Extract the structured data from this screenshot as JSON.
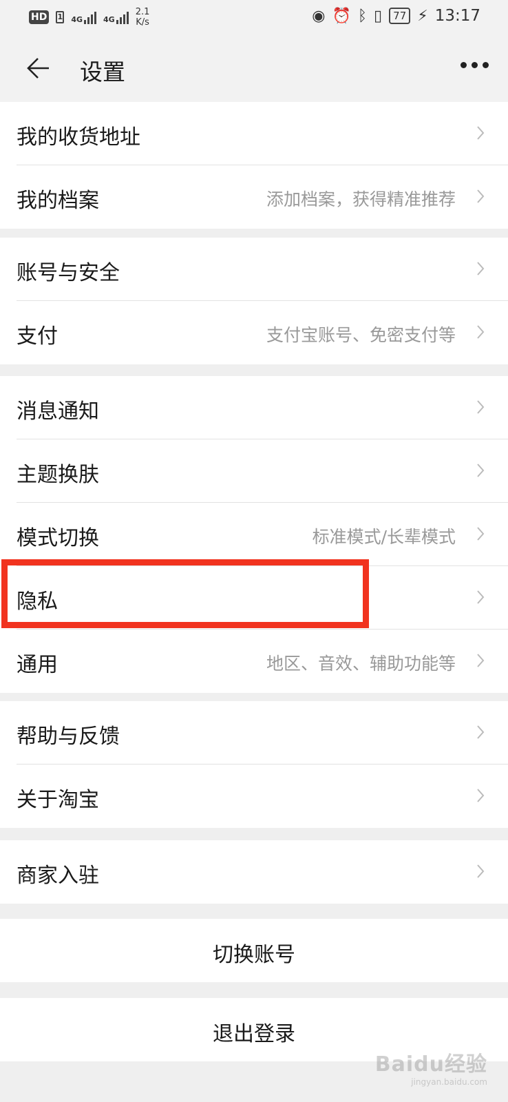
{
  "status_bar": {
    "hd": "HD",
    "sim1": "1",
    "net1": "4G",
    "net2": "4G",
    "speed_value": "2.1",
    "speed_unit": "K/s",
    "battery": "77",
    "time": "13:17"
  },
  "header": {
    "title": "设置"
  },
  "groups": [
    {
      "items": [
        {
          "label": "我的收货地址",
          "hint": ""
        },
        {
          "label": "我的档案",
          "hint": "添加档案，获得精准推荐"
        }
      ]
    },
    {
      "items": [
        {
          "label": "账号与安全",
          "hint": ""
        },
        {
          "label": "支付",
          "hint": "支付宝账号、免密支付等"
        }
      ]
    },
    {
      "items": [
        {
          "label": "消息通知",
          "hint": ""
        },
        {
          "label": "主题换肤",
          "hint": ""
        },
        {
          "label": "模式切换",
          "hint": "标准模式/长辈模式"
        },
        {
          "label": "隐私",
          "hint": ""
        },
        {
          "label": "通用",
          "hint": "地区、音效、辅助功能等"
        }
      ]
    },
    {
      "items": [
        {
          "label": "帮助与反馈",
          "hint": ""
        },
        {
          "label": "关于淘宝",
          "hint": ""
        }
      ]
    },
    {
      "items": [
        {
          "label": "商家入驻",
          "hint": ""
        }
      ]
    }
  ],
  "actions": {
    "switch_account": "切换账号",
    "logout": "退出登录"
  },
  "watermark": {
    "brand": "Baidu经验",
    "url": "jingyan.baidu.com"
  },
  "colors": {
    "highlight": "#f1331f",
    "background": "#efefef",
    "hint_text": "#999999"
  }
}
